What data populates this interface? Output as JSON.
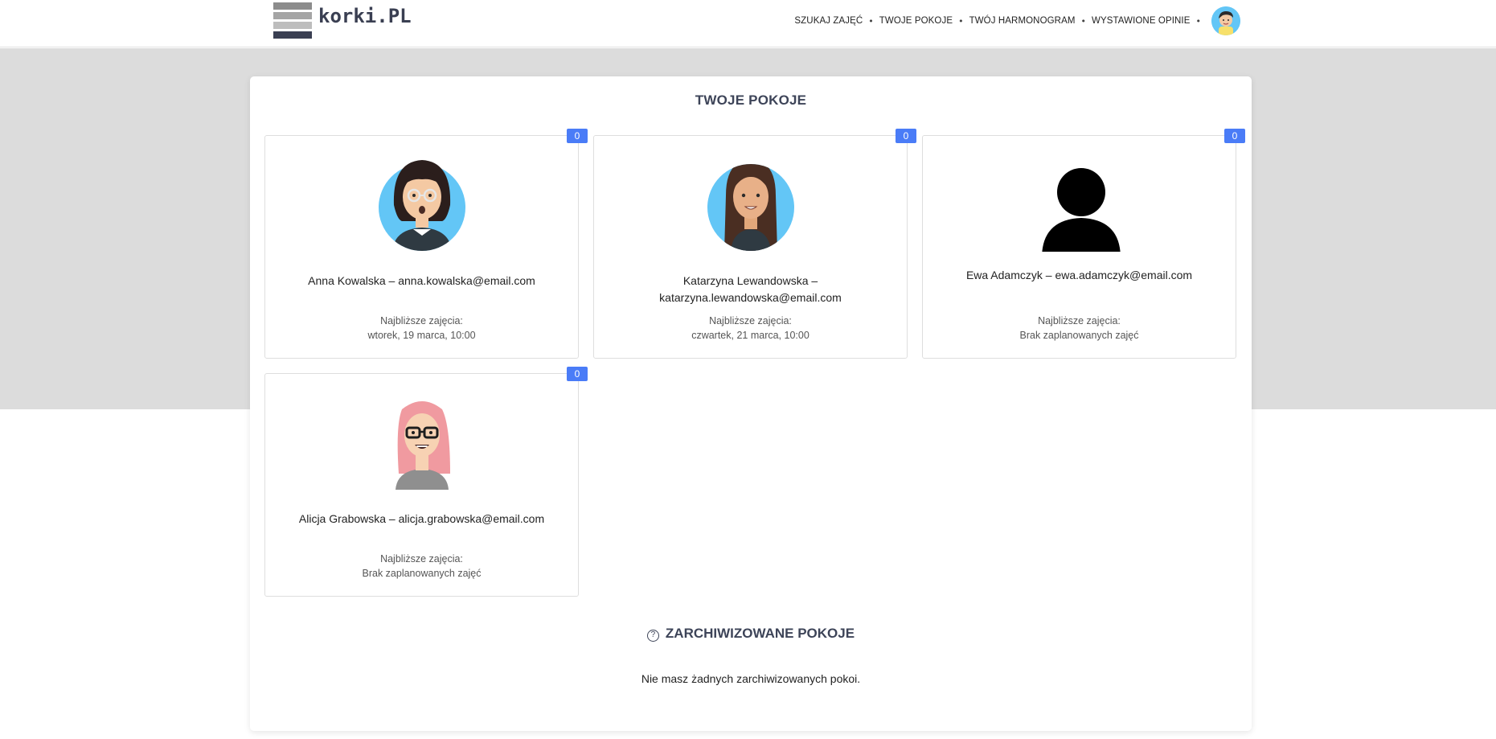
{
  "brand": {
    "logo_text": "korki.PL",
    "logo_colors": [
      "#8c8c8c",
      "#a5a5a5",
      "#bdbdbd",
      "#3a3f52"
    ]
  },
  "nav": {
    "items": [
      "SZUKAJ ZAJĘĆ",
      "TWOJE POKOJE",
      "TWÓJ HARMONOGRAM",
      "WYSTAWIONE OPINIE"
    ],
    "separator": "•",
    "avatar_icon": "user-avatar-icon"
  },
  "page": {
    "title": "TWOJE POKOJE",
    "next_label": "Najbliższe zajęcia:",
    "accent": "#4a7cf7"
  },
  "rooms": [
    {
      "name": "Anna Kowalska – anna.kowalska@email.com",
      "badge": "0",
      "next": "wtorek, 19 marca, 10:00",
      "avatar": "woman-glasses-avatar-icon"
    },
    {
      "name": "Katarzyna Lewandowska – katarzyna.lewandowska@email.com",
      "badge": "0",
      "next": "czwartek, 21 marca, 10:00",
      "avatar": "woman-long-hair-avatar-icon"
    },
    {
      "name": "Ewa Adamczyk – ewa.adamczyk@email.com",
      "badge": "0",
      "next": "Brak zaplanowanych zajęć",
      "avatar": "default-user-silhouette-icon"
    },
    {
      "name": "Alicja Grabowska – alicja.grabowska@email.com",
      "badge": "0",
      "next": "Brak zaplanowanych zajęć",
      "avatar": "woman-pink-hair-avatar-icon"
    }
  ],
  "archive": {
    "title": "ZARCHIWIZOWANE POKOJE",
    "icon": "question-circle-icon",
    "empty_text": "Nie masz żadnych zarchiwizowanych pokoi."
  }
}
